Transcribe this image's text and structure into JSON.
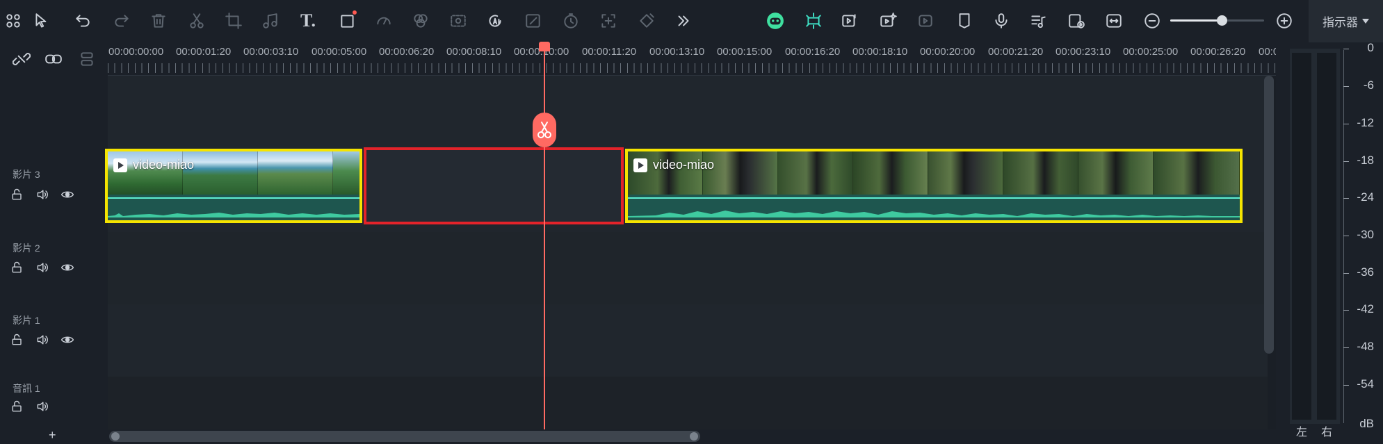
{
  "toolbar": {
    "text_tool_label": "T.",
    "meter_tab": "指示器",
    "zoom_level": 0.6,
    "accent_color": "#3fe0c5"
  },
  "ruler": {
    "timecodes": [
      "00:00:00:00",
      "00:00:01:20",
      "00:00:03:10",
      "00:00:05:00",
      "00:00:06:20",
      "00:00:08:10",
      "00:00:10:00",
      "00:00:11:20",
      "00:00:13:10",
      "00:00:15:00",
      "00:00:16:20",
      "00:00:18:10",
      "00:00:20:00",
      "00:00:21:20",
      "00:00:23:10",
      "00:00:25:00",
      "00:00:26:20",
      "00:0"
    ]
  },
  "tracks": {
    "video3": "影片 3",
    "video2": "影片 2",
    "video1": "影片 1",
    "audio1": "音訊 1",
    "add_label": "+"
  },
  "clips": {
    "left_title": "video-miao",
    "right_title": "video-miao"
  },
  "meter": {
    "db_labels": [
      "0",
      "-6",
      "-12",
      "-18",
      "-24",
      "-30",
      "-36",
      "-42",
      "-48",
      "-54",
      "dB"
    ],
    "left_channel": "左",
    "right_channel": "右"
  },
  "colors": {
    "selection_yellow": "#f5e400",
    "gap_red": "#e3232a",
    "playhead": "#ff6a62"
  }
}
